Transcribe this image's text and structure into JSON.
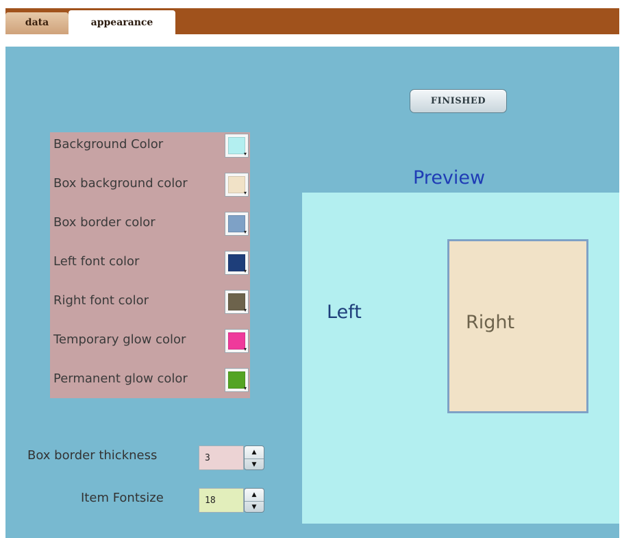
{
  "tabs": [
    {
      "label": "data",
      "active": false
    },
    {
      "label": "appearance",
      "active": true
    }
  ],
  "finished_label": "FINISHED",
  "color_settings": [
    {
      "label": "Background Color",
      "color": "#b3eff0"
    },
    {
      "label": "Box background color",
      "color": "#f1e2c7"
    },
    {
      "label": "Box border color",
      "color": "#7ea1c6"
    },
    {
      "label": "Left font color",
      "color": "#1e3e7a"
    },
    {
      "label": "Right font color",
      "color": "#6d634c"
    },
    {
      "label": "Temporary glow color",
      "color": "#ef3a9b"
    },
    {
      "label": "Permanent glow color",
      "color": "#54a424"
    }
  ],
  "box_border_thickness": {
    "label": "Box border thickness",
    "value": "3"
  },
  "item_fontsize": {
    "label": "Item Fontsize",
    "value": "18"
  },
  "preview": {
    "title": "Preview",
    "left_label": "Left",
    "right_label": "Right"
  },
  "colors": {
    "tab_bar": "#a0521c",
    "panel": "#78b9d0",
    "color_panel": "#c7a3a4",
    "thickness_input_bg": "#ecd3d4",
    "fontsize_input_bg": "#e2eebb",
    "preview_title": "#1f3cb5"
  }
}
